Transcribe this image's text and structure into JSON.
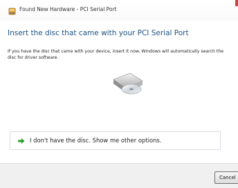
{
  "window": {
    "title": "Found New Hardware - PCI Serial Port",
    "icon": "hardware-icon"
  },
  "main": {
    "heading": "Insert the disc that came with your PCI Serial Port",
    "description": "If you have the disc that came with your device, insert it now.  Windows will automatically search the disc for driver software.",
    "image": "disc-drive-image"
  },
  "option": {
    "icon": "green-arrow-icon",
    "label": "I don't have the disc.  Show me other options."
  },
  "footer": {
    "cancel_label": "Cancel"
  }
}
